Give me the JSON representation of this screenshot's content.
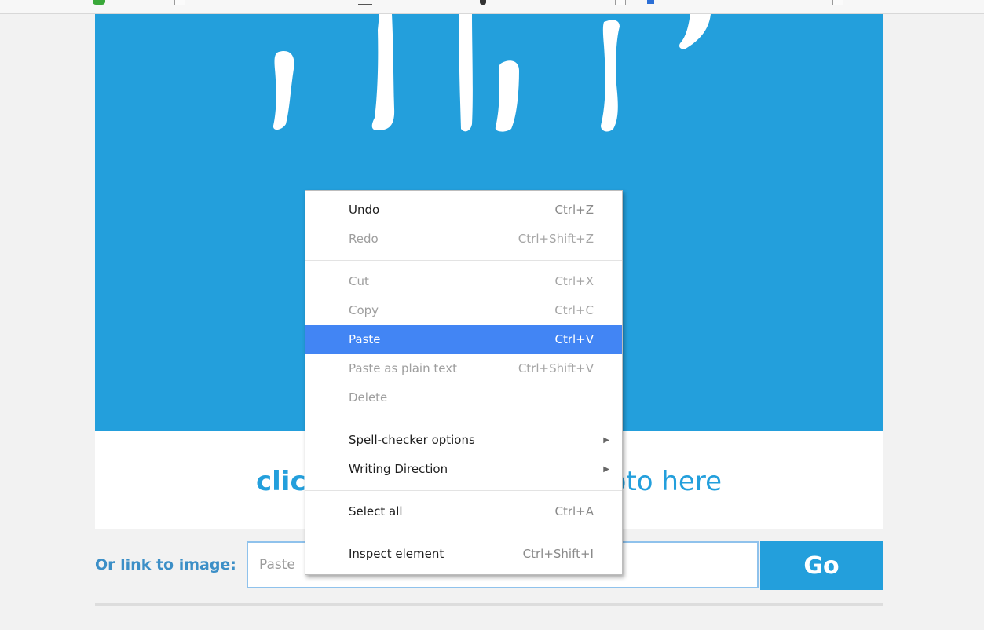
{
  "upload": {
    "click_here": "click here",
    "rest_text": "ur photo here"
  },
  "link_row": {
    "label": "Or link to image:",
    "input_placeholder": "Paste",
    "go_label": "Go"
  },
  "context_menu": {
    "undo": {
      "label": "Undo",
      "shortcut": "Ctrl+Z"
    },
    "redo": {
      "label": "Redo",
      "shortcut": "Ctrl+Shift+Z"
    },
    "cut": {
      "label": "Cut",
      "shortcut": "Ctrl+X"
    },
    "copy": {
      "label": "Copy",
      "shortcut": "Ctrl+C"
    },
    "paste": {
      "label": "Paste",
      "shortcut": "Ctrl+V"
    },
    "paste_plain": {
      "label": "Paste as plain text",
      "shortcut": "Ctrl+Shift+V"
    },
    "delete": {
      "label": "Delete"
    },
    "spell_checker": {
      "label": "Spell-checker options"
    },
    "writing_direction": {
      "label": "Writing Direction"
    },
    "select_all": {
      "label": "Select all",
      "shortcut": "Ctrl+A"
    },
    "inspect": {
      "label": "Inspect element",
      "shortcut": "Ctrl+Shift+I"
    }
  },
  "colors": {
    "brand_blue": "#239fdc",
    "menu_highlight": "#4285f4",
    "page_bg": "#f2f2f2"
  }
}
